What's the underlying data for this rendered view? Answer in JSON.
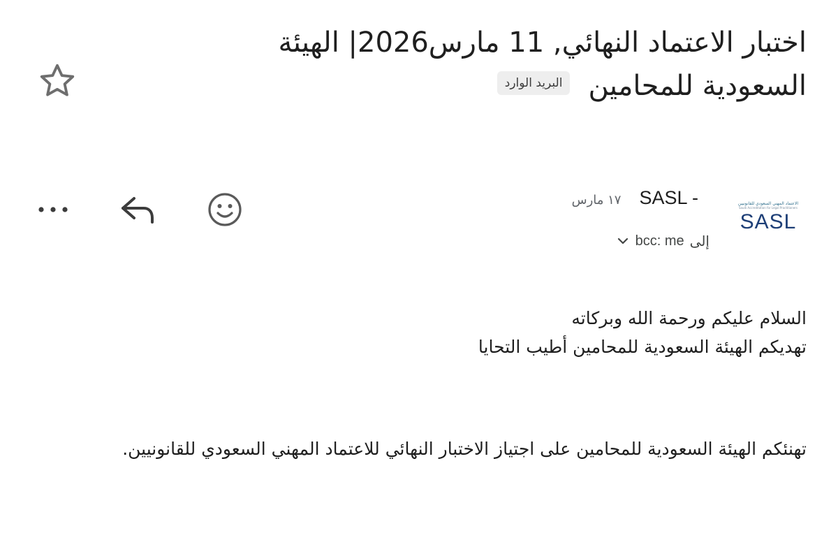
{
  "email": {
    "subject_line1": "اختبار الاعتماد النهائي, 11 مارس2026| الهيئة",
    "subject_line2": "السعودية للمحامين",
    "label": "البريد الوارد",
    "sender": {
      "name": "SASL -",
      "date": "١٧ مارس",
      "avatar": {
        "tagline_ar": "الاعتماد المهني السعودي للقانونيين",
        "tagline_en": "Saudi Accreditation for Legal Practitioners",
        "mark": "SASL"
      }
    },
    "recipient": {
      "to_label": "إلى",
      "value": "bcc: me"
    },
    "body": {
      "greeting": "السلام عليكم ورحمة الله وبركاته",
      "intro": "تهديكم الهيئة السعودية للمحامين أطيب التحايا",
      "paragraph": "تهنئكم الهيئة السعودية للمحامين على اجتياز الاختبار النهائي للاعتماد المهني السعودي للقانونيين."
    }
  },
  "icons": {
    "star": "star-outline-icon",
    "more": "more-horizontal-icon",
    "reply": "reply-icon",
    "emoji": "emoji-smile-icon",
    "chevron": "chevron-down-icon"
  },
  "colors": {
    "text": "#1f1f1f",
    "muted": "#5f6368",
    "chip_bg": "#eeeeee",
    "brand_navy": "#1e3f77"
  }
}
